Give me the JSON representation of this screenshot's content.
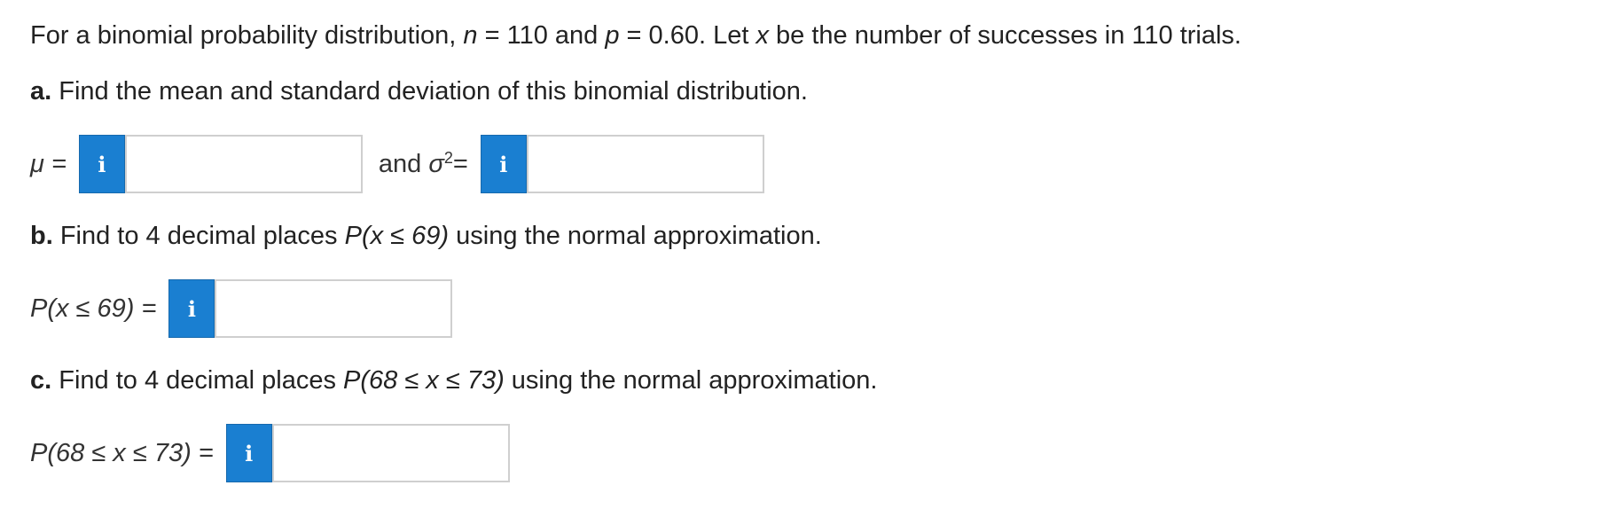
{
  "intro": {
    "t1": "For a binomial probability distribution, ",
    "n_var": "n",
    "t2": " = 110 and ",
    "p_var": "p",
    "t3": " = 0.60. Let ",
    "x_var": "x",
    "t4": " be the number of successes in 110 trials."
  },
  "part_a": {
    "letter": "a.",
    "prompt": " Find the mean and standard deviation of this binomial distribution.",
    "mu_label": "μ =",
    "and_text": "and ",
    "sigma_symbol": "σ",
    "sigma_sup": "2",
    "sigma_eq": " =",
    "mu_value": "",
    "sigma_value": ""
  },
  "part_b": {
    "letter": "b.",
    "prompt_pre": " Find to 4 decimal places ",
    "prompt_expr": "P(x ≤ 69)",
    "prompt_post": " using the normal approximation.",
    "answer_label": "P(x ≤ 69) =",
    "value": ""
  },
  "part_c": {
    "letter": "c.",
    "prompt_pre": " Find to 4 decimal places ",
    "prompt_expr": "P(68 ≤ x ≤ 73)",
    "prompt_post": " using the normal approximation.",
    "answer_label": "P(68 ≤ x ≤ 73) =",
    "value": ""
  },
  "info_button_glyph": "i",
  "colors": {
    "info_button": "#1a7fd1",
    "text": "#222222",
    "input_border": "#cfcfcf"
  }
}
